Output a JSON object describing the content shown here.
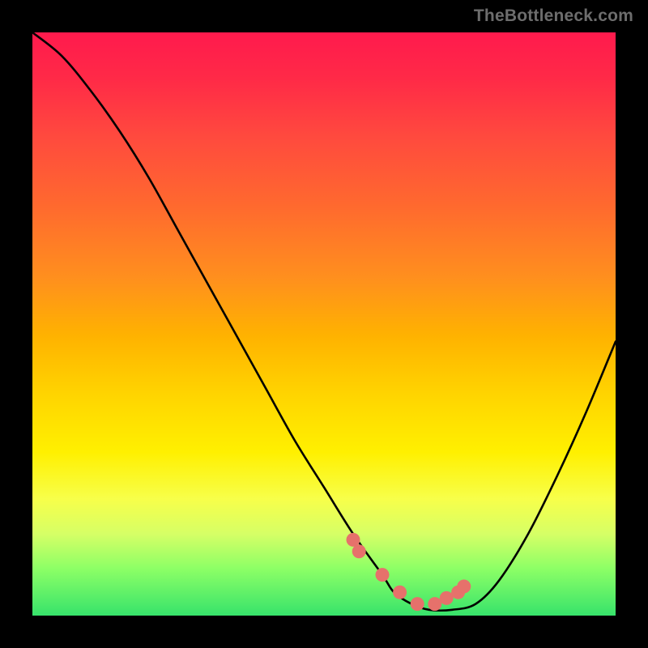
{
  "watermark": "TheBottleneck.com",
  "chart_data": {
    "type": "line",
    "title": "",
    "xlabel": "",
    "ylabel": "",
    "xlim": [
      0,
      100
    ],
    "ylim": [
      0,
      100
    ],
    "series": [
      {
        "name": "bottleneck-curve",
        "x": [
          0,
          5,
          10,
          15,
          20,
          25,
          30,
          35,
          40,
          45,
          50,
          55,
          60,
          62,
          65,
          68,
          72,
          76,
          80,
          85,
          90,
          95,
          100
        ],
        "values": [
          100,
          96,
          90,
          83,
          75,
          66,
          57,
          48,
          39,
          30,
          22,
          14,
          7,
          4,
          2,
          1,
          1,
          2,
          6,
          14,
          24,
          35,
          47
        ]
      },
      {
        "name": "highlight-dots",
        "x": [
          55,
          56,
          60,
          63,
          66,
          69,
          71,
          73,
          74
        ],
        "values": [
          13,
          11,
          7,
          4,
          2,
          2,
          3,
          4,
          5
        ]
      }
    ],
    "colors": {
      "curve": "#000000",
      "dots": "#e6716b"
    },
    "background_gradient": [
      "#ff1a4d",
      "#ffd400",
      "#37e36b"
    ]
  }
}
